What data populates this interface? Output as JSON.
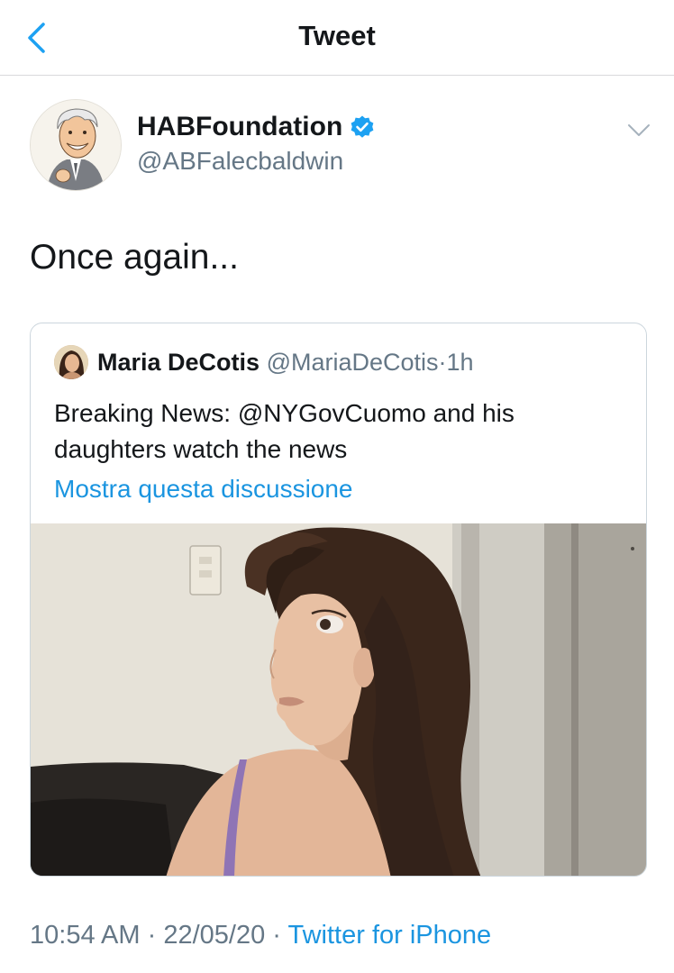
{
  "header": {
    "title": "Tweet",
    "back_icon": "chevron-left-icon"
  },
  "author": {
    "name": "HABFoundation",
    "handle": "@ABFalecbaldwin",
    "verified": true
  },
  "tweet": {
    "text": "Once again..."
  },
  "quoted_tweet": {
    "author_name": "Maria DeCotis",
    "author_handle": "@MariaDeCotis",
    "separator": "·",
    "time": "1h",
    "text": "Breaking News: @NYGovCuomo and his daughters watch the news",
    "show_thread_label": "Mostra questa discussione"
  },
  "footer": {
    "time": "10:54 AM",
    "sep1": "·",
    "date": "22/05/20",
    "sep2": "·",
    "source": "Twitter for iPhone"
  },
  "colors": {
    "accent": "#1da1f2",
    "link": "#1b95e0",
    "secondary_text": "#657786",
    "border": "#ccd6dd"
  }
}
